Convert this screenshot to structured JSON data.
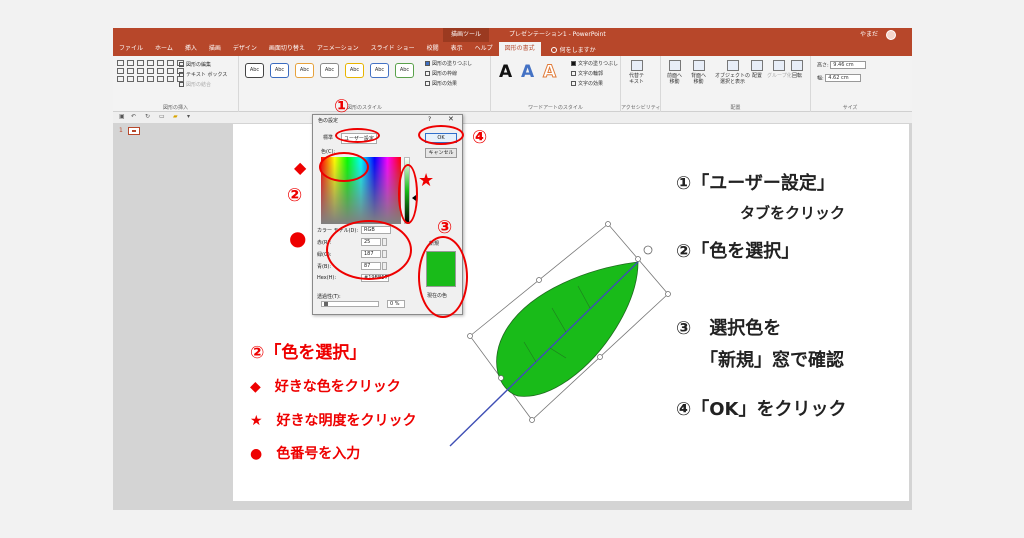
{
  "titlebar": {
    "context_tab": "描画ツール",
    "doc_title": "プレゼンテーション1 - PowerPoint",
    "user": "やまだ"
  },
  "tabs": [
    "ファイル",
    "ホーム",
    "挿入",
    "描画",
    "デザイン",
    "画面切り替え",
    "アニメーション",
    "スライド ショー",
    "校閲",
    "表示",
    "ヘルプ",
    "図形の書式"
  ],
  "tell_me": "何をしますか",
  "ribbon": {
    "insert_shapes": {
      "edit_shape": "図形の編集",
      "text_box": "テキスト ボックス",
      "merge": "図形の結合",
      "label": "図形の挿入"
    },
    "shape_styles": {
      "abc": "Abc",
      "fill": "図形の塗りつぶし",
      "outline": "図形の枠線",
      "effects": "図形の効果",
      "label": "図形のスタイル",
      "colors": [
        "#444444",
        "#3a6bbf",
        "#e6a23c",
        "#8a8a8a",
        "#e8b400",
        "#4472c4",
        "#5aa14b"
      ]
    },
    "wordart": {
      "letter": "A",
      "text_fill": "文字の塗りつぶし",
      "text_outline": "文字の輪郭",
      "text_effects": "文字の効果",
      "label": "ワードアートのスタイル"
    },
    "accessibility": {
      "alt_text_1": "代替テ",
      "alt_text_2": "キスト",
      "label": "アクセシビリティ"
    },
    "arrange": {
      "forward_1": "前面へ",
      "forward_2": "移動",
      "backward_1": "背面へ",
      "backward_2": "移動",
      "selection_1": "オブジェクトの",
      "selection_2": "選択と表示",
      "align": "配置",
      "group": "グループ化",
      "rotate": "回転",
      "label": "配置"
    },
    "size": {
      "height_label": "高さ:",
      "height": "9.46 cm",
      "width_label": "幅:",
      "width": "4.62 cm",
      "label": "サイズ"
    }
  },
  "thumb": {
    "number": "1"
  },
  "dialog": {
    "title": "色の設定",
    "help": "?",
    "close": "✕",
    "tab_standard": "標準",
    "tab_custom": "ユーザー設定",
    "ok": "OK",
    "cancel": "キャンセル",
    "colors_label": "色(C):",
    "model_label": "カラー モデル(D):",
    "model_value": "RGB",
    "red_label": "赤(R):",
    "red": "25",
    "green_label": "緑(G):",
    "green": "187",
    "blue_label": "青(B):",
    "blue": "87",
    "hex_label": "Hex(H):",
    "hex": "#19BB57",
    "new_label": "新規",
    "current_label": "現在の色",
    "transparency_label": "透過性(T):",
    "transparency": "0 %",
    "new_color": "#19bb19"
  },
  "annotations": {
    "n1": "①",
    "n2": "②",
    "n3": "③",
    "n4": "④",
    "diamond": "◆",
    "star": "★",
    "dot": "●",
    "left": {
      "title": "②「色を選択」",
      "line1": "◆　好きな色をクリック",
      "line2": "★　好きな明度をクリック",
      "line3": "●　色番号を入力"
    },
    "right": {
      "step1a": "①「ユーザー設定」",
      "step1b": "タブをクリック",
      "step2": "②「色を選択」",
      "step3a": "③　選択色を",
      "step3b": "「新規」窓で確認",
      "step4": "④「OK」をクリック"
    }
  },
  "leaf": {
    "fill": "#19bb19",
    "stem": "#3f4fb5"
  }
}
